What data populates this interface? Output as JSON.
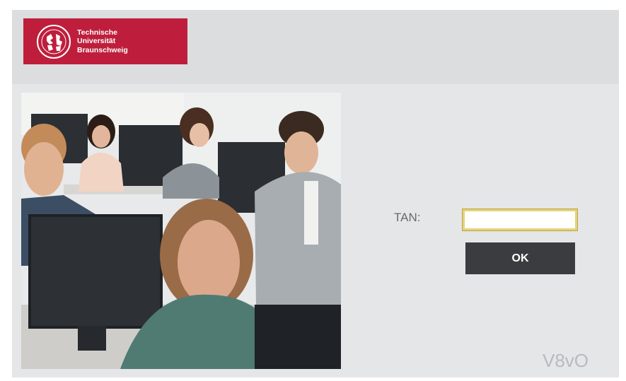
{
  "logo": {
    "line1": "Technische",
    "line2": "Universität",
    "line3": "Braunschweig",
    "color": "#be1e3c",
    "icon": "tu-braunschweig-seal"
  },
  "form": {
    "tan_label": "TAN:",
    "tan_value": "",
    "ok_label": "OK"
  },
  "brand_mark": "V8vO",
  "colors": {
    "background": "#e5e6e8",
    "button": "#3b3c3f",
    "focus": "#e7d275"
  }
}
